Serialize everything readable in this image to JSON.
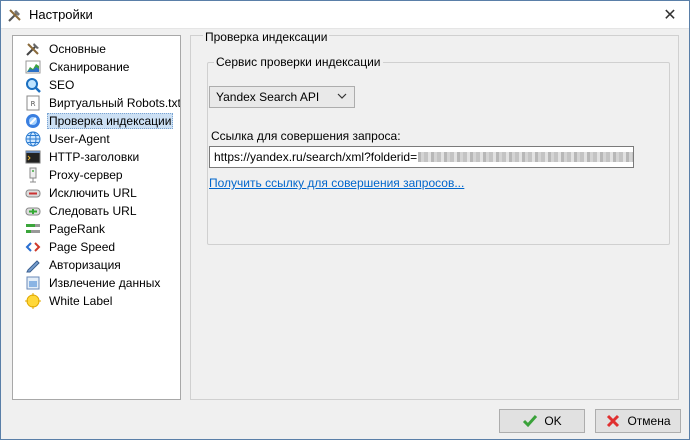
{
  "window": {
    "title": "Настройки"
  },
  "sidebar": {
    "items": [
      {
        "label": "Основные",
        "icon": "tools-icon"
      },
      {
        "label": "Сканирование",
        "icon": "chart-icon"
      },
      {
        "label": "SEO",
        "icon": "magnifier-icon"
      },
      {
        "label": "Виртуальный Robots.txt",
        "icon": "robots-file-icon"
      },
      {
        "label": "Проверка индексации",
        "icon": "index-check-icon",
        "selected": true
      },
      {
        "label": "User-Agent",
        "icon": "globe-icon"
      },
      {
        "label": "HTTP-заголовки",
        "icon": "terminal-icon"
      },
      {
        "label": "Proxy-сервер",
        "icon": "proxy-icon"
      },
      {
        "label": "Исключить URL",
        "icon": "exclude-url-icon"
      },
      {
        "label": "Следовать URL",
        "icon": "follow-url-icon"
      },
      {
        "label": "PageRank",
        "icon": "pagerank-icon"
      },
      {
        "label": "Page Speed",
        "icon": "code-icon"
      },
      {
        "label": "Авторизация",
        "icon": "pen-icon"
      },
      {
        "label": "Извлечение данных",
        "icon": "extract-icon"
      },
      {
        "label": "White Label",
        "icon": "white-label-icon"
      }
    ]
  },
  "panel": {
    "title": "Проверка индексации",
    "group_title": "Сервис проверки индексации",
    "service_select": {
      "value": "Yandex Search API"
    },
    "url_label": "Ссылка для совершения запроса:",
    "url_value": "https://yandex.ru/search/xml?folderid=",
    "get_link": "Получить ссылку для совершения запросов..."
  },
  "buttons": {
    "ok": "OK",
    "cancel": "Отмена"
  },
  "colors": {
    "selection": "#cce0f4",
    "link": "#0066cc",
    "ok_check": "#3aa23a",
    "cancel_x": "#e03030"
  }
}
